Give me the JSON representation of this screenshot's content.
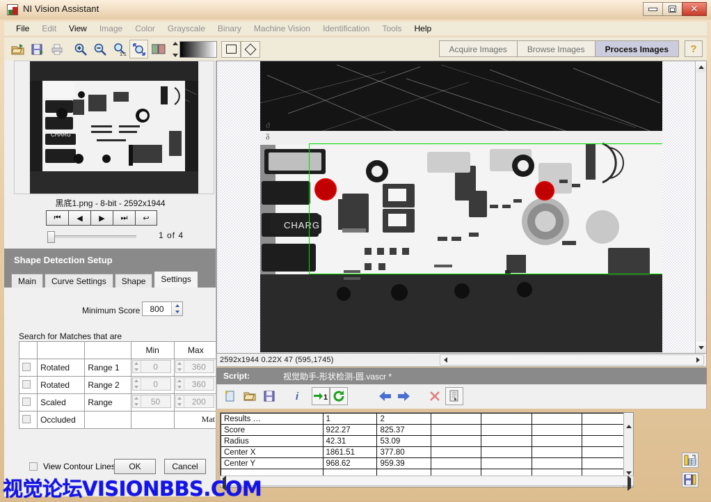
{
  "window": {
    "title": "NI Vision Assistant",
    "icon": "app-icon",
    "minimize": "–",
    "maximize": "❐",
    "close": "✕"
  },
  "menu": {
    "items": [
      {
        "label": "File",
        "enabled": true
      },
      {
        "label": "Edit",
        "enabled": false
      },
      {
        "label": "View",
        "enabled": true
      },
      {
        "label": "Image",
        "enabled": false
      },
      {
        "label": "Color",
        "enabled": false
      },
      {
        "label": "Grayscale",
        "enabled": false
      },
      {
        "label": "Binary",
        "enabled": false
      },
      {
        "label": "Machine Vision",
        "enabled": false
      },
      {
        "label": "Identification",
        "enabled": false
      },
      {
        "label": "Tools",
        "enabled": false
      },
      {
        "label": "Help",
        "enabled": true
      }
    ]
  },
  "toolbar": {
    "icons": [
      "open-image-icon",
      "save-image-icon",
      "print-icon",
      "zoom-in-icon",
      "zoom-out-icon",
      "zoom-1to1-icon",
      "zoom-fit-icon",
      "image-pair-icon"
    ],
    "shape_rect": "rectangle-tool",
    "shape_rotated_rect": "rotated-rectangle-tool",
    "modes": [
      {
        "label": "Acquire Images",
        "active": false
      },
      {
        "label": "Browse Images",
        "active": false
      },
      {
        "label": "Process Images",
        "active": true
      }
    ],
    "help_label": "?"
  },
  "left_panel": {
    "image_info": "黑底1.png - 8-bit - 2592x1944",
    "nav_buttons": [
      "⏮",
      "◀",
      "▶",
      "⏭",
      "↩"
    ],
    "counter": "1  of  4",
    "section_title": "Shape Detection Setup",
    "tabs": [
      {
        "label": "Main",
        "active": false
      },
      {
        "label": "Curve Settings",
        "active": false
      },
      {
        "label": "Shape",
        "active": false
      },
      {
        "label": "Settings",
        "active": true
      }
    ],
    "minimum_score_label": "Minimum Score",
    "minimum_score_value": "800",
    "search_label": "Search for Matches that are",
    "table": {
      "headers": [
        "",
        "",
        "",
        "Min",
        "Max"
      ],
      "rows": [
        {
          "checked": false,
          "name": "Rotated",
          "range": "Range 1",
          "min": "0",
          "max": "360"
        },
        {
          "checked": false,
          "name": "Rotated",
          "range": "Range 2",
          "min": "0",
          "max": "360"
        },
        {
          "checked": false,
          "name": "Scaled",
          "range": "Range",
          "min": "50",
          "max": "200"
        },
        {
          "checked": false,
          "name": "Occluded",
          "range": "",
          "min": "",
          "max": "Mat"
        }
      ]
    },
    "view_contour_label": "View Contour Lines",
    "view_contour_checked": false,
    "ok_label": "OK",
    "cancel_label": "Cancel"
  },
  "main_area": {
    "status": "2592x1944 0.22X 47   (595,1745)",
    "roi_color": "#00e000",
    "match_color": "#c00000"
  },
  "script": {
    "label": "Script:",
    "filename": "视觉助手-形状检测-圆.vascr *",
    "tools": [
      "new-script-icon",
      "open-script-icon",
      "save-script-icon",
      "info-icon",
      "run-once-icon",
      "run-continuous-icon",
      "step-back-icon",
      "step-forward-icon",
      "delete-step-icon",
      "copy-step-icon"
    ]
  },
  "results": {
    "header": [
      "Results …",
      "1",
      "2",
      "",
      "",
      "",
      ""
    ],
    "rows": [
      {
        "name": "Score",
        "v1": "922.27",
        "v2": "825.37"
      },
      {
        "name": "Radius",
        "v1": "42.31",
        "v2": "53.09"
      },
      {
        "name": "Center X",
        "v1": "1861.51",
        "v2": "377.80"
      },
      {
        "name": "Center Y",
        "v1": "968.62",
        "v2": "959.39"
      }
    ],
    "side_icons": [
      "export-table-icon",
      "save-measurements-icon"
    ]
  },
  "watermark": "视觉论坛VISIONBBS.COM"
}
